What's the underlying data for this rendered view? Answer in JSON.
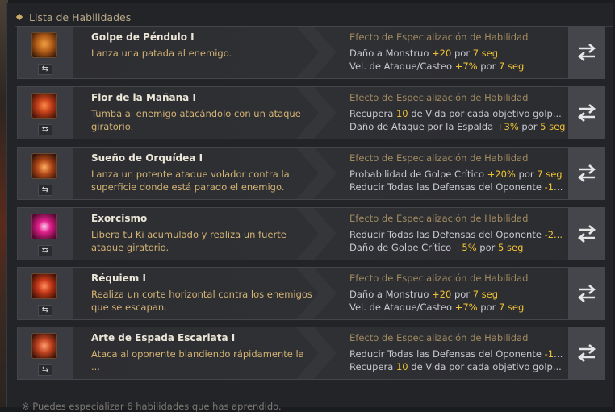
{
  "header": {
    "title": "Lista de Habilidades"
  },
  "colors": {
    "accent": "#f0c233",
    "gold_text": "#d4b374",
    "spec_title": "#a08a60"
  },
  "skills": [
    {
      "name": "Golpe de Péndulo I",
      "desc": "Lanza una patada al enemigo.",
      "icon": "kick-skill-icon",
      "spec_title": "Efecto de Especialización de Habilidad",
      "effects": [
        {
          "a": "Daño a Monstruo ",
          "b": "+20",
          "c": " por ",
          "d": "7 seg"
        },
        {
          "a": "Vel. de Ataque/Casteo ",
          "b": "+7%",
          "c": " por ",
          "d": "7 seg"
        }
      ]
    },
    {
      "name": "Flor de la Mañana I",
      "desc": "Tumba al enemigo atacándolo con un ataque giratorio.",
      "icon": "spin-skill-icon",
      "spec_title": "Efecto de Especialización de Habilidad",
      "effects": [
        {
          "a": "Recupera ",
          "b": "10",
          "c": " de Vida por cada objetivo golp...",
          "d": ""
        },
        {
          "a": "Daño de Ataque por la Espalda ",
          "b": "+3%",
          "c": " por ",
          "d": "5 seg"
        }
      ]
    },
    {
      "name": "Sueño de Orquídea I",
      "desc": "Lanza un potente ataque volador contra la superficie donde está parado el enemigo.",
      "icon": "flying-strike-icon",
      "spec_title": "Efecto de Especialización de Habilidad",
      "effects": [
        {
          "a": "Probabilidad de Golpe Crítico ",
          "b": "+20%",
          "c": " por ",
          "d": "7 seg"
        },
        {
          "a": "Reducir Todas las Defensas del Oponente ",
          "b": "-15 ...",
          "c": "",
          "d": ""
        }
      ]
    },
    {
      "name": "Exorcismo",
      "desc": "Libera tu Ki acumulado y realiza un fuerte ataque giratorio.",
      "icon": "ki-release-icon",
      "spec_title": "Efecto de Especialización de Habilidad",
      "effects": [
        {
          "a": "Reducir Todas las Defensas del Oponente ",
          "b": "-2...",
          "c": "",
          "d": ""
        },
        {
          "a": "Daño de Golpe Crítico ",
          "b": "+5%",
          "c": " por ",
          "d": "5 seg"
        }
      ]
    },
    {
      "name": "Réquiem I",
      "desc": "Realiza un corte horizontal contra los enemigos que se escapan.",
      "icon": "horizontal-slash-icon",
      "spec_title": "Efecto de Especialización de Habilidad",
      "effects": [
        {
          "a": "Daño a Monstruo ",
          "b": "+20",
          "c": " por ",
          "d": "7 seg"
        },
        {
          "a": "Vel. de Ataque/Casteo ",
          "b": "+7%",
          "c": " por ",
          "d": "7 seg"
        }
      ]
    },
    {
      "name": "Arte de Espada Escarlata I",
      "desc": "Ataca al oponente blandiendo rápidamente la ...",
      "icon": "scarlet-sword-icon",
      "spec_title": "Efecto de Especialización de Habilidad",
      "effects": [
        {
          "a": "Reducir Todas las Defensas del Oponente ",
          "b": "-15",
          "c": " ...",
          "d": ""
        },
        {
          "a": "Recupera ",
          "b": "10",
          "c": " de Vida por cada objetivo golp...",
          "d": ""
        }
      ]
    }
  ],
  "footer": {
    "note": "※ Puedes especializar 6 habilidades que has aprendido."
  }
}
